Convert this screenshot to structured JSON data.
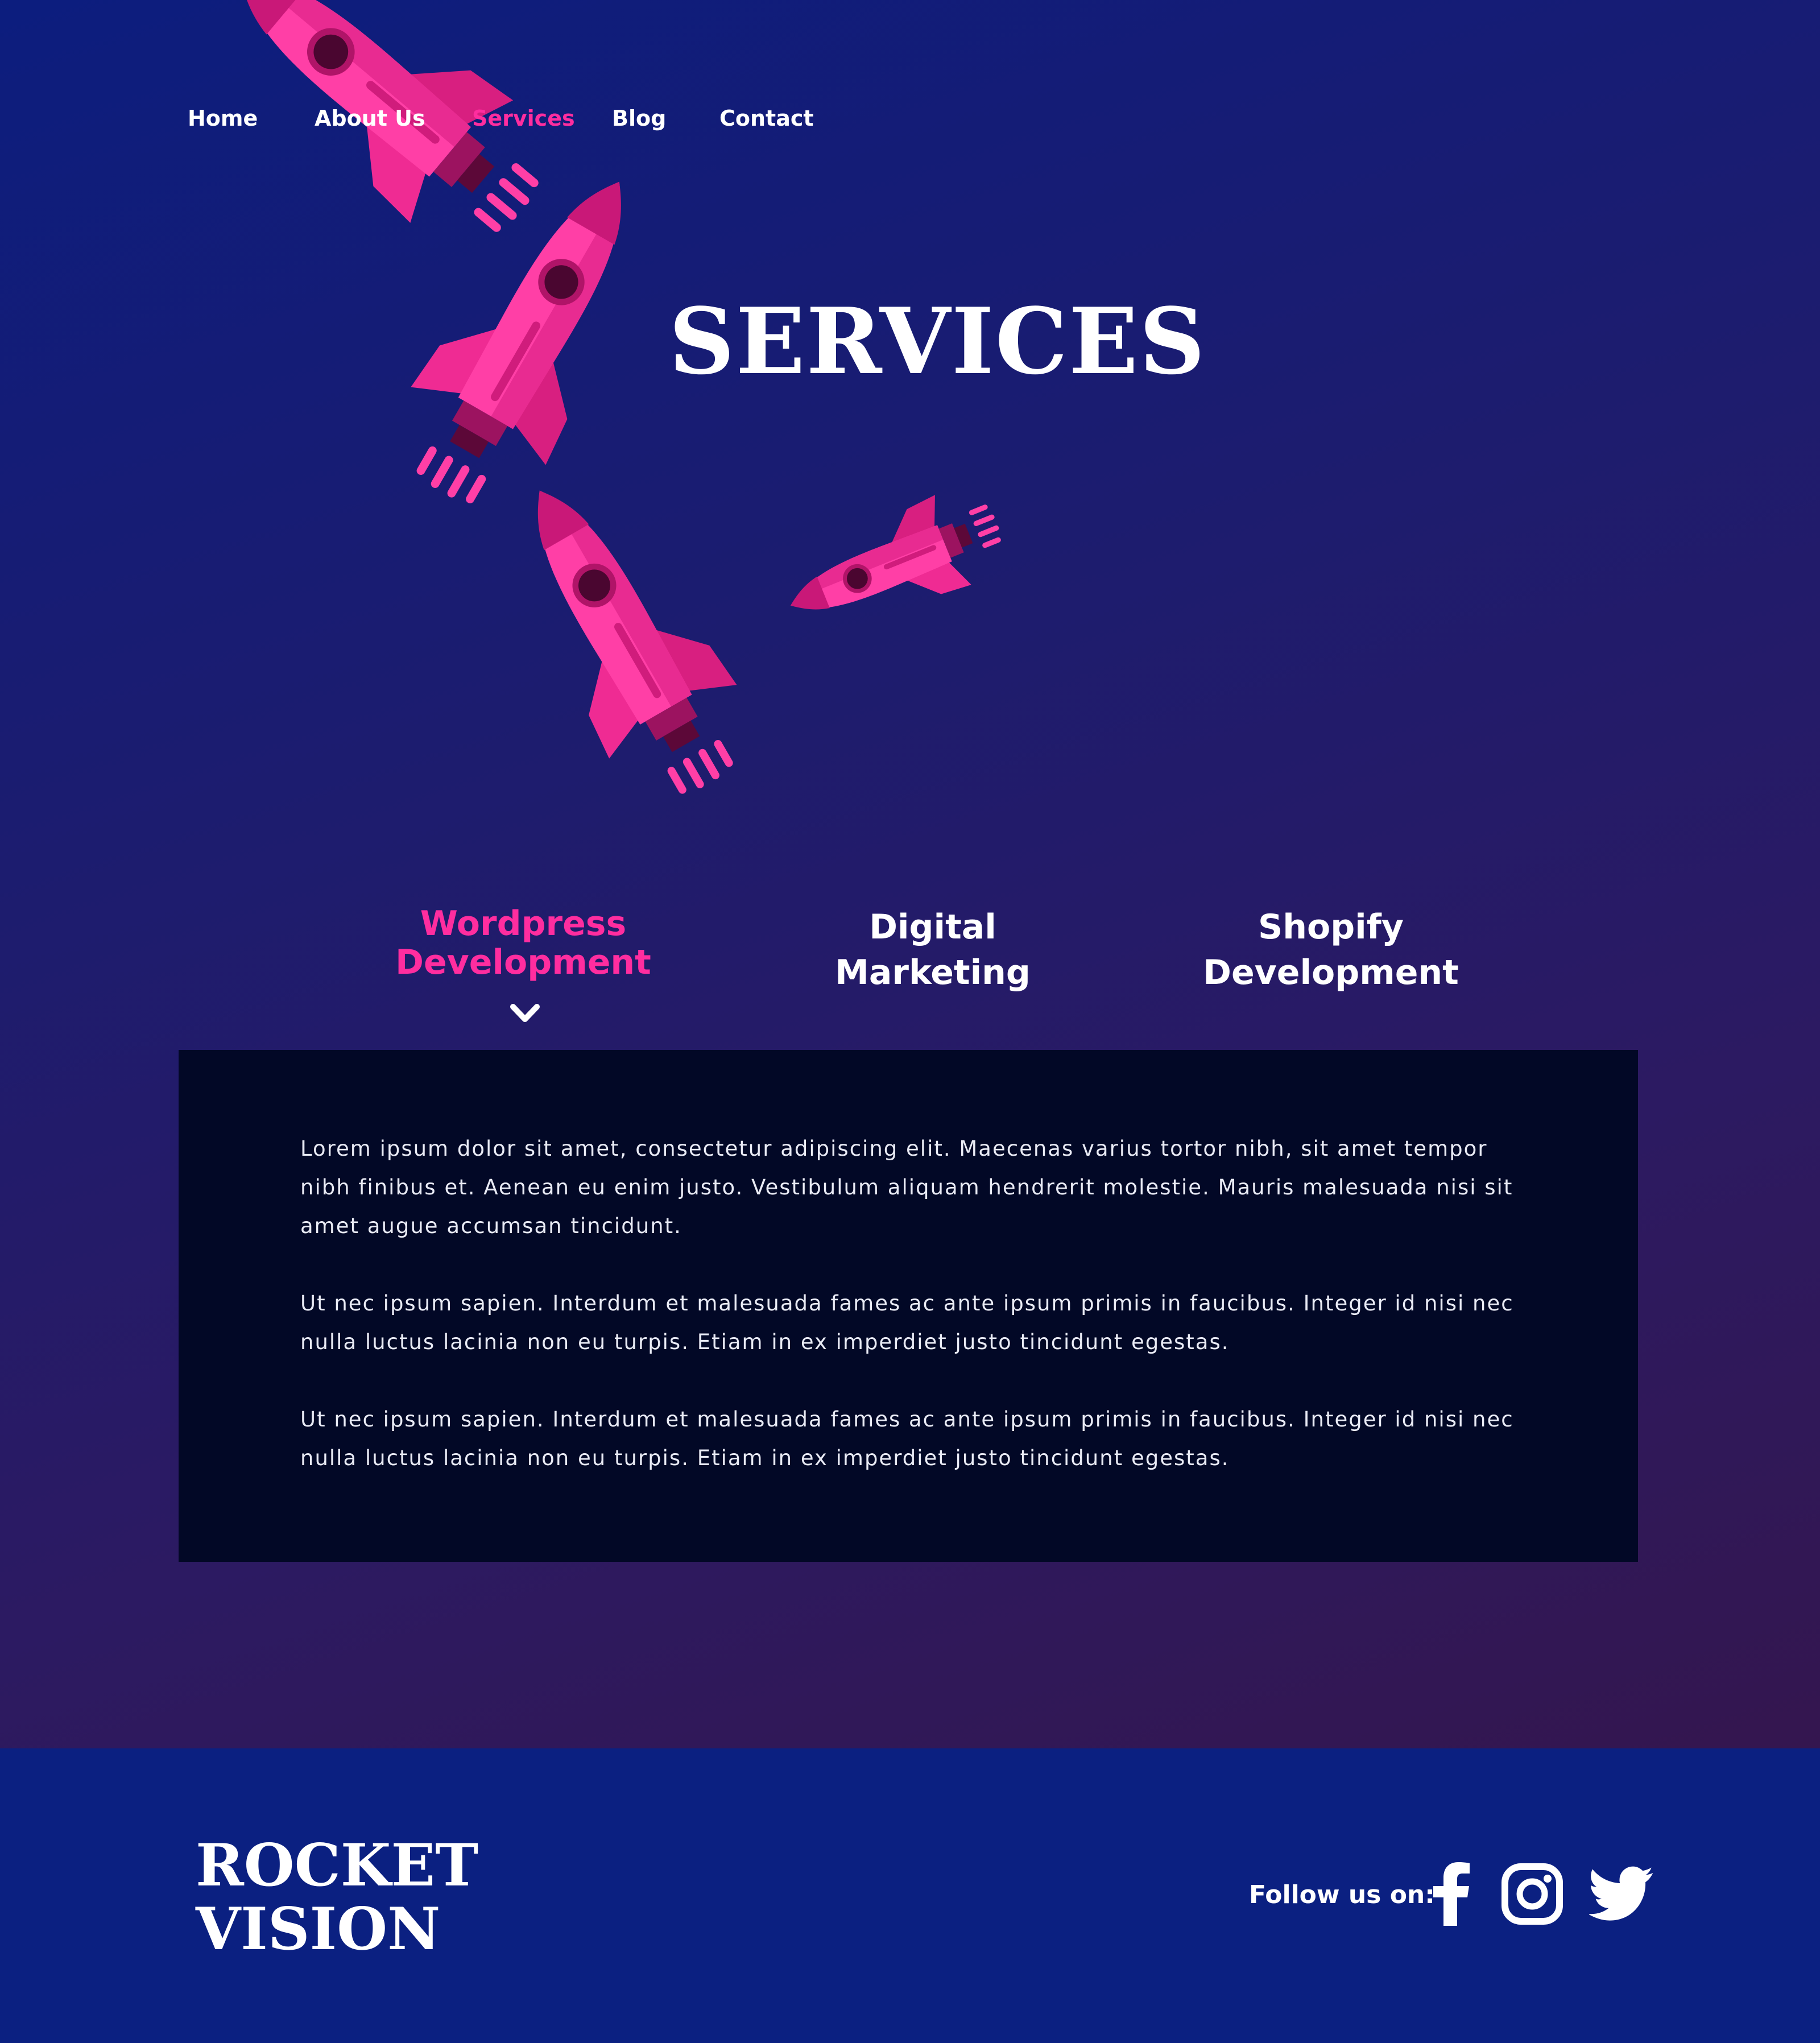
{
  "nav": {
    "items": [
      {
        "label": "Home"
      },
      {
        "label": "About Us"
      },
      {
        "label": "Services"
      },
      {
        "label": "Blog"
      },
      {
        "label": "Contact"
      }
    ],
    "active_index": 2
  },
  "hero": {
    "title": "SERVICES"
  },
  "tabs": {
    "items": [
      {
        "line1": "Wordpress",
        "line2": "Development"
      },
      {
        "line1": "Digital",
        "line2": "Marketing"
      },
      {
        "line1": "Shopify",
        "line2": "Development"
      }
    ],
    "active_index": 0
  },
  "panel": {
    "paragraphs": [
      "Lorem ipsum dolor sit amet, consectetur adipiscing elit. Maecenas varius tortor nibh, sit amet tempor nibh finibus et. Aenean eu enim justo. Vestibulum aliquam hendrerit molestie. Mauris malesuada nisi sit amet augue accumsan tincidunt.",
      " Ut nec ipsum sapien. Interdum et malesuada fames ac ante ipsum primis in faucibus. Integer id nisi nec nulla luctus lacinia non eu turpis. Etiam in ex imperdiet justo tincidunt egestas.",
      " Ut nec ipsum sapien. Interdum et malesuada fames ac ante ipsum primis in faucibus. Integer id nisi nec nulla luctus lacinia non eu turpis. Etiam in ex imperdiet justo tincidunt egestas."
    ]
  },
  "footer": {
    "brand_line1": "ROCKET",
    "brand_line2": "VISION",
    "follow_label": "Follow us on:",
    "social": [
      {
        "icon": "facebook-icon"
      },
      {
        "icon": "instagram-icon"
      },
      {
        "icon": "twitter-icon"
      }
    ]
  },
  "colors": {
    "accent_pink": "#ff2d9f",
    "panel_bg": "#020826",
    "footer_bg": "#0b2081",
    "hero_gradient_start": "#0c1d7e",
    "hero_gradient_end": "#34164f"
  }
}
